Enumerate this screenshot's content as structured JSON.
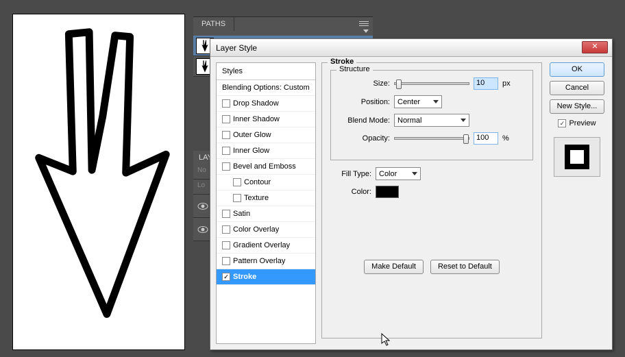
{
  "panels": {
    "paths_tab": "PATHS",
    "layers_tab": "LAY",
    "layers_row1": "No",
    "layers_row2": "Lo"
  },
  "dialog": {
    "title": "Layer Style",
    "close_symbol": "✕",
    "styles_header": "Styles",
    "blending_options": "Blending Options: Custom",
    "style_items": {
      "drop_shadow": "Drop Shadow",
      "inner_shadow": "Inner Shadow",
      "outer_glow": "Outer Glow",
      "inner_glow": "Inner Glow",
      "bevel_emboss": "Bevel and Emboss",
      "contour": "Contour",
      "texture": "Texture",
      "satin": "Satin",
      "color_overlay": "Color Overlay",
      "gradient_overlay": "Gradient Overlay",
      "pattern_overlay": "Pattern Overlay",
      "stroke": "Stroke"
    },
    "group_title": "Stroke",
    "structure_title": "Structure",
    "size_label": "Size:",
    "size_value": "10",
    "size_unit": "px",
    "position_label": "Position:",
    "position_value": "Center",
    "blend_mode_label": "Blend Mode:",
    "blend_mode_value": "Normal",
    "opacity_label": "Opacity:",
    "opacity_value": "100",
    "opacity_unit": "%",
    "fill_type_label": "Fill Type:",
    "fill_type_value": "Color",
    "color_label": "Color:",
    "color_value": "#000000",
    "make_default": "Make Default",
    "reset_default": "Reset to Default",
    "ok": "OK",
    "cancel": "Cancel",
    "new_style": "New Style...",
    "preview_label": "Preview"
  }
}
